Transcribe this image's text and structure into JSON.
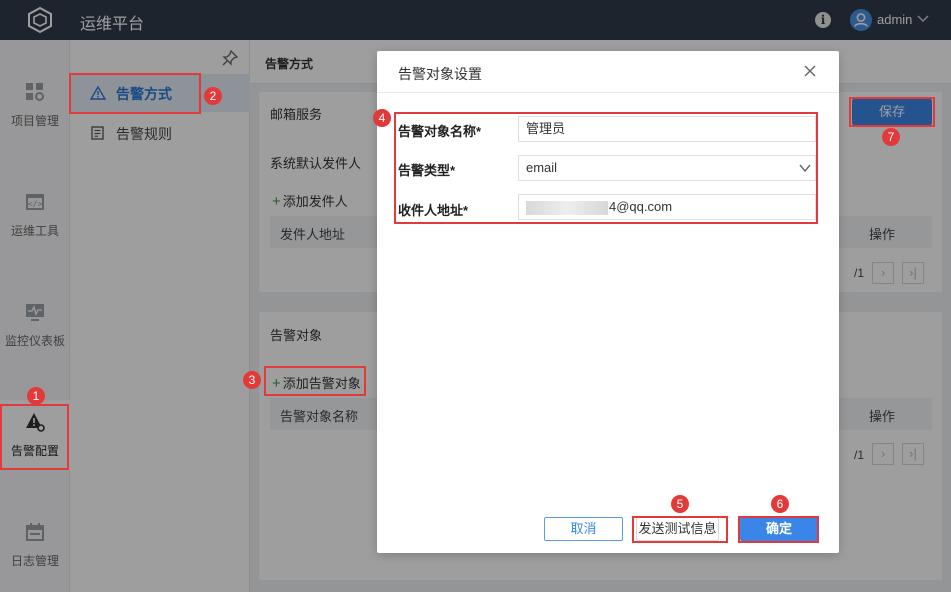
{
  "topbar": {
    "title": "运维平台",
    "user": "admin"
  },
  "rail": {
    "items": [
      {
        "label": "项目管理"
      },
      {
        "label": "运维工具"
      },
      {
        "label": "监控仪表板"
      },
      {
        "label": "告警配置"
      },
      {
        "label": "日志管理"
      }
    ]
  },
  "subnav": {
    "items": [
      {
        "label": "告警方式"
      },
      {
        "label": "告警规则"
      }
    ]
  },
  "main": {
    "header_title": "告警方式",
    "mail_service_title": "邮箱服务",
    "default_sender_label": "系统默认发件人",
    "add_sender": "添加发件人",
    "sender_table": {
      "col_address": "发件人地址",
      "col_actions": "操作"
    },
    "pager_total": "/1",
    "save_label": "保存",
    "alert_target_title": "告警对象",
    "add_target": "添加告警对象",
    "target_table": {
      "col_name": "告警对象名称",
      "col_actions": "操作"
    }
  },
  "dialog": {
    "title": "告警对象设置",
    "fields": {
      "name_label": "告警对象名称*",
      "name_value": "管理员",
      "type_label": "告警类型*",
      "type_value": "email",
      "recipient_label": "收件人地址*",
      "recipient_value": "4@qq.com"
    },
    "buttons": {
      "cancel": "取消",
      "test": "发送测试信息",
      "ok": "确定"
    }
  },
  "annotations": [
    "1",
    "2",
    "3",
    "4",
    "5",
    "6",
    "7"
  ],
  "colors": {
    "accent": "#3a86e8",
    "topbar": "#2f3a4b",
    "highlight": "#e23a3a"
  }
}
